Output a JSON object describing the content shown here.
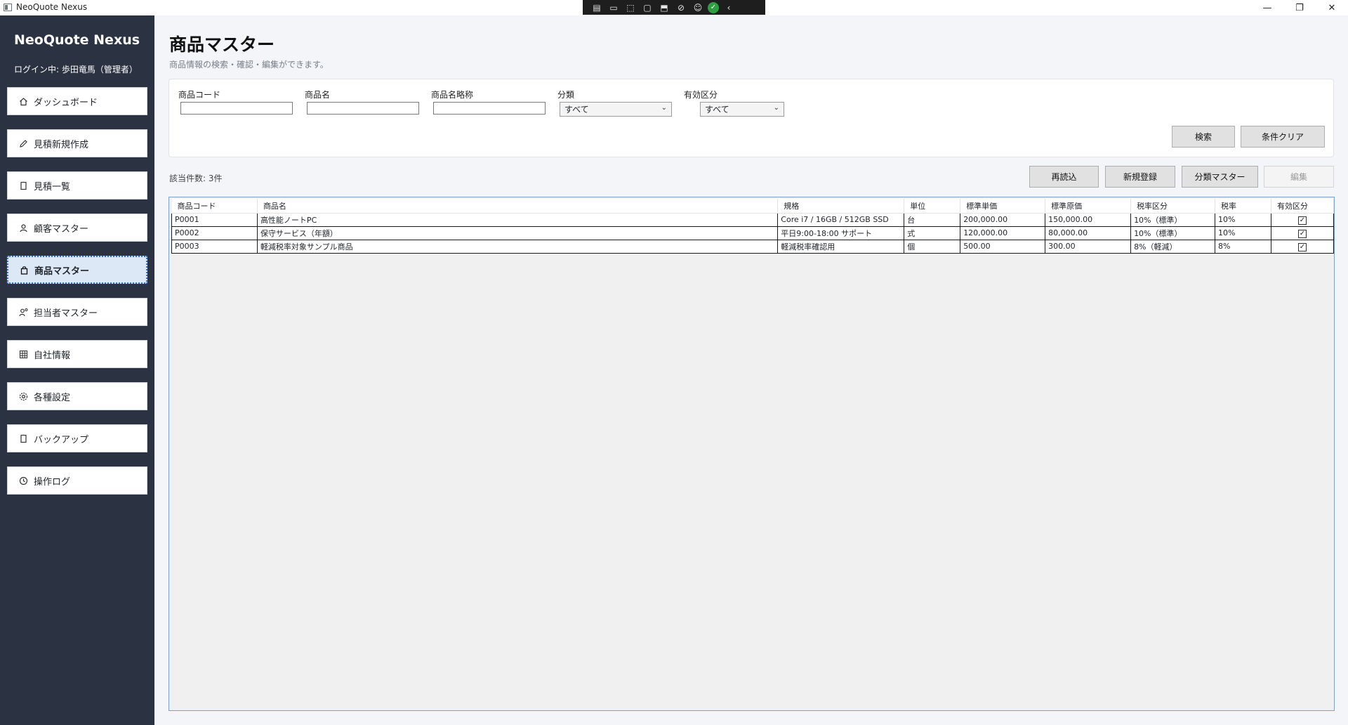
{
  "window": {
    "title": "NeoQuote Nexus"
  },
  "sidebar": {
    "brand": "NeoQuote Nexus",
    "login": "ログイン中: 歩田竜馬（管理者）",
    "items": [
      {
        "label": "ダッシュボード",
        "icon": "home-icon"
      },
      {
        "label": "見積新規作成",
        "icon": "pencil-icon"
      },
      {
        "label": "見積一覧",
        "icon": "document-icon"
      },
      {
        "label": "顧客マスター",
        "icon": "person-icon"
      },
      {
        "label": "商品マスター",
        "icon": "bag-icon",
        "active": true
      },
      {
        "label": "担当者マスター",
        "icon": "person-gear-icon"
      },
      {
        "label": "自社情報",
        "icon": "grid-icon"
      },
      {
        "label": "各種設定",
        "icon": "gear-icon"
      },
      {
        "label": "バックアップ",
        "icon": "document-icon"
      },
      {
        "label": "操作ログ",
        "icon": "clock-icon"
      }
    ]
  },
  "main": {
    "title": "商品マスター",
    "subtitle": "商品情報の検索・確認・編集ができます。",
    "filters": {
      "code_label": "商品コード",
      "code_value": "",
      "name_label": "商品名",
      "name_value": "",
      "short_label": "商品名略称",
      "short_value": "",
      "category_label": "分類",
      "category_value": "すべて",
      "valid_label": "有効区分",
      "valid_value": "すべて",
      "search_button": "検索",
      "clear_button": "条件クリア"
    },
    "count_label": "該当件数: 3件",
    "actions": {
      "reload": "再読込",
      "new": "新規登録",
      "category_master": "分類マスター",
      "edit": "編集"
    },
    "table": {
      "columns": [
        "商品コード",
        "商品名",
        "規格",
        "単位",
        "標準単価",
        "標準原価",
        "税率区分",
        "税率",
        "有効区分"
      ],
      "rows": [
        [
          "P0001",
          "高性能ノートPC",
          "Core i7 / 16GB / 512GB SSD",
          "台",
          "200,000.00",
          "150,000.00",
          "10%（標準）",
          "10%",
          true
        ],
        [
          "P0002",
          "保守サービス（年額）",
          "平日9:00-18:00 サポート",
          "式",
          "120,000.00",
          "80,000.00",
          "10%（標準）",
          "10%",
          true
        ],
        [
          "P0003",
          "軽減税率対象サンプル商品",
          "軽減税率確認用",
          "個",
          "500.00",
          "300.00",
          "8%（軽減）",
          "8%",
          true
        ]
      ]
    }
  },
  "colors": {
    "sidebar": "#2b3242",
    "active_nav": "#dde8f7",
    "accent": "#2f6fd1"
  }
}
